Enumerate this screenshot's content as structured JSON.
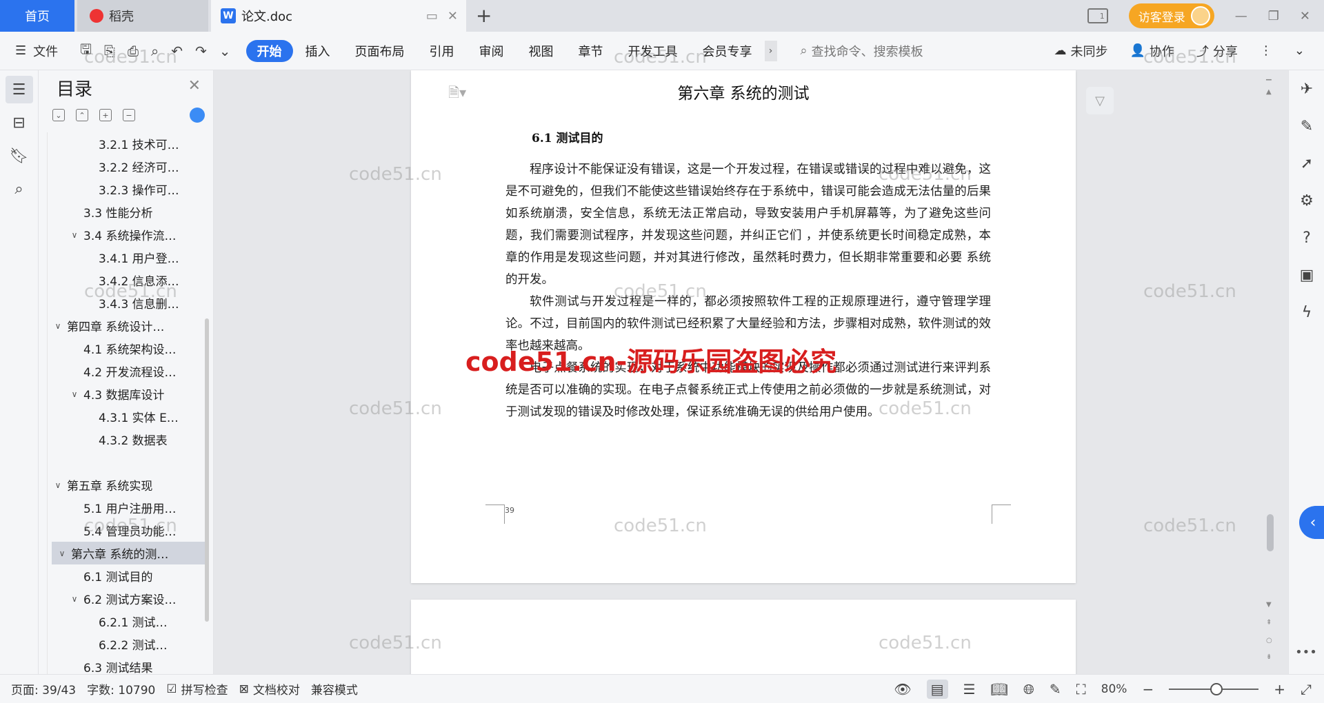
{
  "titlebar": {
    "home_tab": "首页",
    "daoke_tab": "稻壳",
    "doc_tab": "论文.doc",
    "new_tab": "+",
    "login_button": "访客登录"
  },
  "ribbon": {
    "file_label": "文件",
    "tabs": [
      "开始",
      "插入",
      "页面布局",
      "引用",
      "审阅",
      "视图",
      "章节",
      "开发工具",
      "会员专享"
    ],
    "search_placeholder": "查找命令、搜索模板",
    "sync_label": "未同步",
    "collab_label": "协作",
    "share_label": "分享"
  },
  "toc": {
    "title": "目录",
    "items": [
      {
        "label": "3.2.1 技术可…",
        "level": 3,
        "caret": ""
      },
      {
        "label": "3.2.2 经济可…",
        "level": 3,
        "caret": ""
      },
      {
        "label": "3.2.3 操作可…",
        "level": 3,
        "caret": ""
      },
      {
        "label": "3.3 性能分析",
        "level": 2,
        "caret": ""
      },
      {
        "label": "3.4 系统操作流…",
        "level": 2,
        "caret": "∨"
      },
      {
        "label": "3.4.1 用户登…",
        "level": 3,
        "caret": ""
      },
      {
        "label": "3.4.2 信息添…",
        "level": 3,
        "caret": ""
      },
      {
        "label": "3.4.3 信息删…",
        "level": 3,
        "caret": ""
      },
      {
        "label": "第四章  系统设计…",
        "level": 1,
        "caret": "∨"
      },
      {
        "label": "4.1 系统架构设…",
        "level": 2,
        "caret": ""
      },
      {
        "label": "4.2 开发流程设…",
        "level": 2,
        "caret": ""
      },
      {
        "label": "4.3 数据库设计",
        "level": 2,
        "caret": "∨"
      },
      {
        "label": "4.3.1 实体 E…",
        "level": 3,
        "caret": ""
      },
      {
        "label": "4.3.2 数据表",
        "level": 3,
        "caret": ""
      },
      {
        "label": "",
        "level": 0,
        "caret": ""
      },
      {
        "label": "第五章  系统实现",
        "level": 1,
        "caret": "∨"
      },
      {
        "label": "5.1 用户注册用…",
        "level": 2,
        "caret": ""
      },
      {
        "label": "5.4  管理员功能…",
        "level": 2,
        "caret": ""
      },
      {
        "label": "第六章    系统的测…",
        "level": 1,
        "caret": "∨"
      },
      {
        "label": "6.1  测试目的",
        "level": 2,
        "caret": ""
      },
      {
        "label": "6.2  测试方案设…",
        "level": 2,
        "caret": "∨"
      },
      {
        "label": "6.2.1  测试…",
        "level": 3,
        "caret": ""
      },
      {
        "label": "6.2.2  测试…",
        "level": 3,
        "caret": ""
      },
      {
        "label": "6.3  测试结果",
        "level": 2,
        "caret": ""
      }
    ]
  },
  "document": {
    "chapter_title": "第六章    系统的测试",
    "section_title": "6.1  测试目的",
    "paragraphs": [
      "程序设计不能保证没有错误，这是一个开发过程，在错误或错误的过程中难以避免，这是不可避免的，但我们不能使这些错误始终存在于系统中，错误可能会造成无法估量的后果  如系统崩溃，安全信息，系统无法正常启动，导致安装用户手机屏幕等，为了避免这些问题，我们需要测试程序，并发现这些问题，并纠正它们  ，并使系统更长时间稳定成熟，本章的作用是发现这些问题，并对其进行修改，虽然耗时费力，但长期非常重要和必要  系统的开发。",
      "软件测试与开发过程是一样的，都必须按照软件工程的正规原理进行，遵守管理学理论。不过，目前国内的软件测试已经积累了大量经验和方法，步骤相对成熟，软件测试的效率也越来越高。",
      "电子点餐系统的实现，对于系统中功能模块的实现及操作都必须通过测试进行来评判系统是否可以准确的实现。在电子点餐系统正式上传使用之前必须做的一步就是系统测试，对于测试发现的错误及时修改处理，保证系统准确无误的供给用户使用。"
    ],
    "page_number": "39"
  },
  "statusbar": {
    "page": "页面: 39/43",
    "words": "字数: 10790",
    "spell": "拼写检查",
    "proof": "文档校对",
    "compat": "兼容模式",
    "zoom": "80%",
    "zoom_level_percent": 80
  },
  "watermarks": {
    "small": "code51.cn",
    "red": "code51.cn-源码乐园盗图必究"
  }
}
